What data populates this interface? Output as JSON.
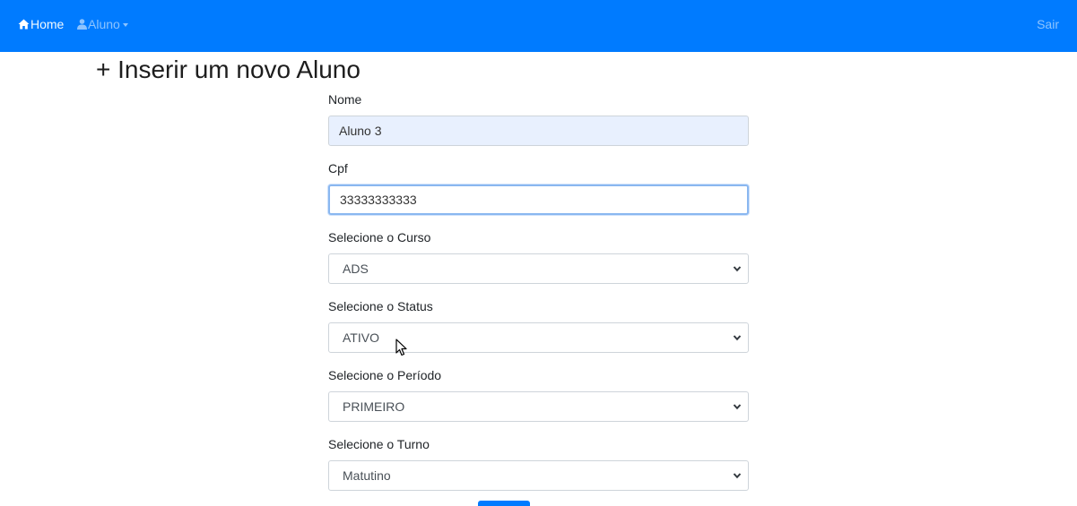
{
  "navbar": {
    "home_label": "Home",
    "aluno_label": "Aluno",
    "logout_label": "Sair",
    "color": "#007bff"
  },
  "page": {
    "title": "+ Inserir um novo Aluno"
  },
  "form": {
    "nome": {
      "label": "Nome",
      "value": "Aluno 3"
    },
    "cpf": {
      "label": "Cpf",
      "value": "33333333333"
    },
    "curso": {
      "label": "Selecione o Curso",
      "selected": "ADS"
    },
    "status": {
      "label": "Selecione o Status",
      "selected": "ATIVO"
    },
    "periodo": {
      "label": "Selecione o Período",
      "selected": "PRIMEIRO"
    },
    "turno": {
      "label": "Selecione o Turno",
      "selected": "Matutino"
    }
  },
  "icons": {
    "home": "home-icon",
    "user": "user-icon",
    "dropdown": "caret-down-icon",
    "select_chevron": "chevron-down-icon",
    "pointer": "mouse-pointer-icon"
  }
}
